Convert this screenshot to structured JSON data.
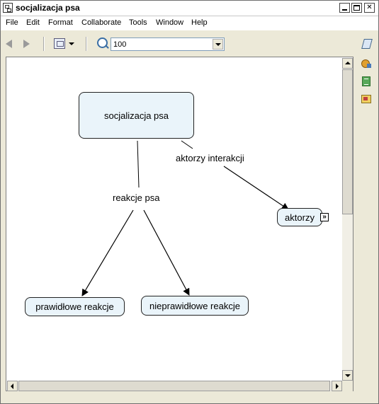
{
  "window": {
    "title": "socjalizacja psa"
  },
  "menu": [
    "File",
    "Edit",
    "Format",
    "Collaborate",
    "Tools",
    "Window",
    "Help"
  ],
  "toolbar": {
    "zoom_value": "100"
  },
  "concepts": {
    "root": "socjalizacja psa",
    "actors": "aktorzy",
    "correct": "prawidłowe reakcje",
    "incorrect": "nieprawidłowe reakcje"
  },
  "links": {
    "interaction_actors": "aktorzy interakcji",
    "dog_reactions": "reakcje psa"
  }
}
